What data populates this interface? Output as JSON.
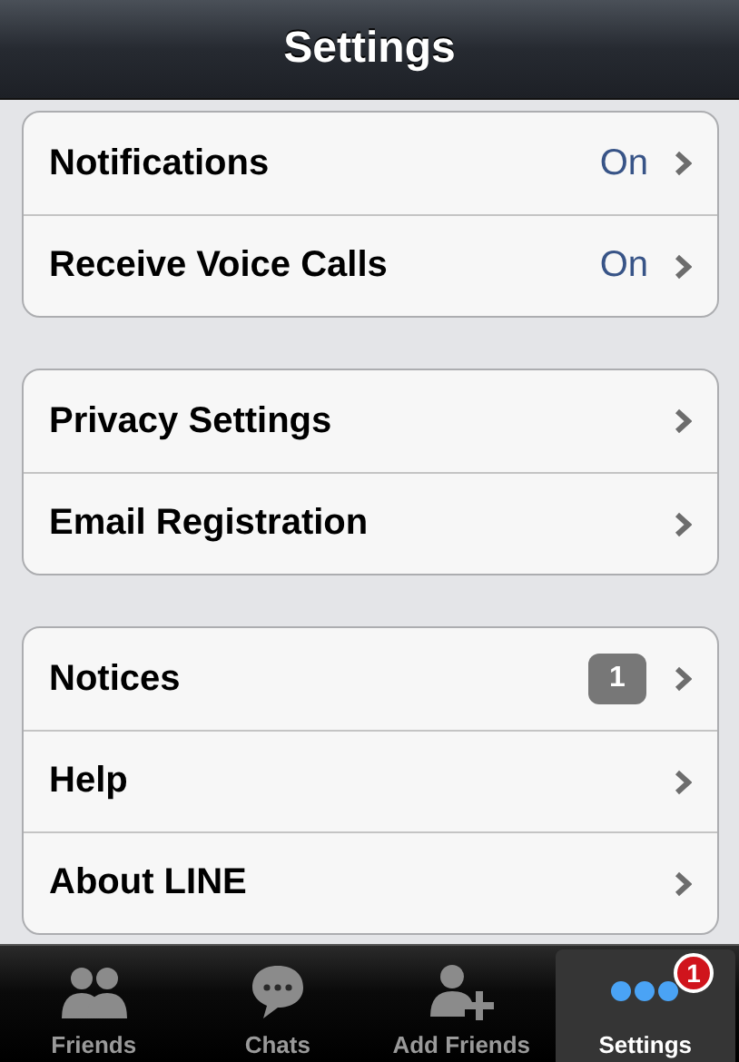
{
  "header": {
    "title": "Settings"
  },
  "groups": [
    {
      "rows": [
        {
          "label": "Notifications",
          "value": "On"
        },
        {
          "label": "Receive Voice Calls",
          "value": "On"
        }
      ]
    },
    {
      "rows": [
        {
          "label": "Privacy Settings"
        },
        {
          "label": "Email Registration"
        }
      ]
    },
    {
      "rows": [
        {
          "label": "Notices",
          "badge": "1"
        },
        {
          "label": "Help"
        },
        {
          "label": "About LINE"
        }
      ]
    }
  ],
  "tabs": [
    {
      "kind": "friends",
      "label": "Friends",
      "selected": false
    },
    {
      "kind": "chats",
      "label": "Chats",
      "selected": false
    },
    {
      "kind": "add",
      "label": "Add Friends",
      "selected": false
    },
    {
      "kind": "more",
      "label": "Settings",
      "selected": true,
      "badge": "1"
    }
  ]
}
